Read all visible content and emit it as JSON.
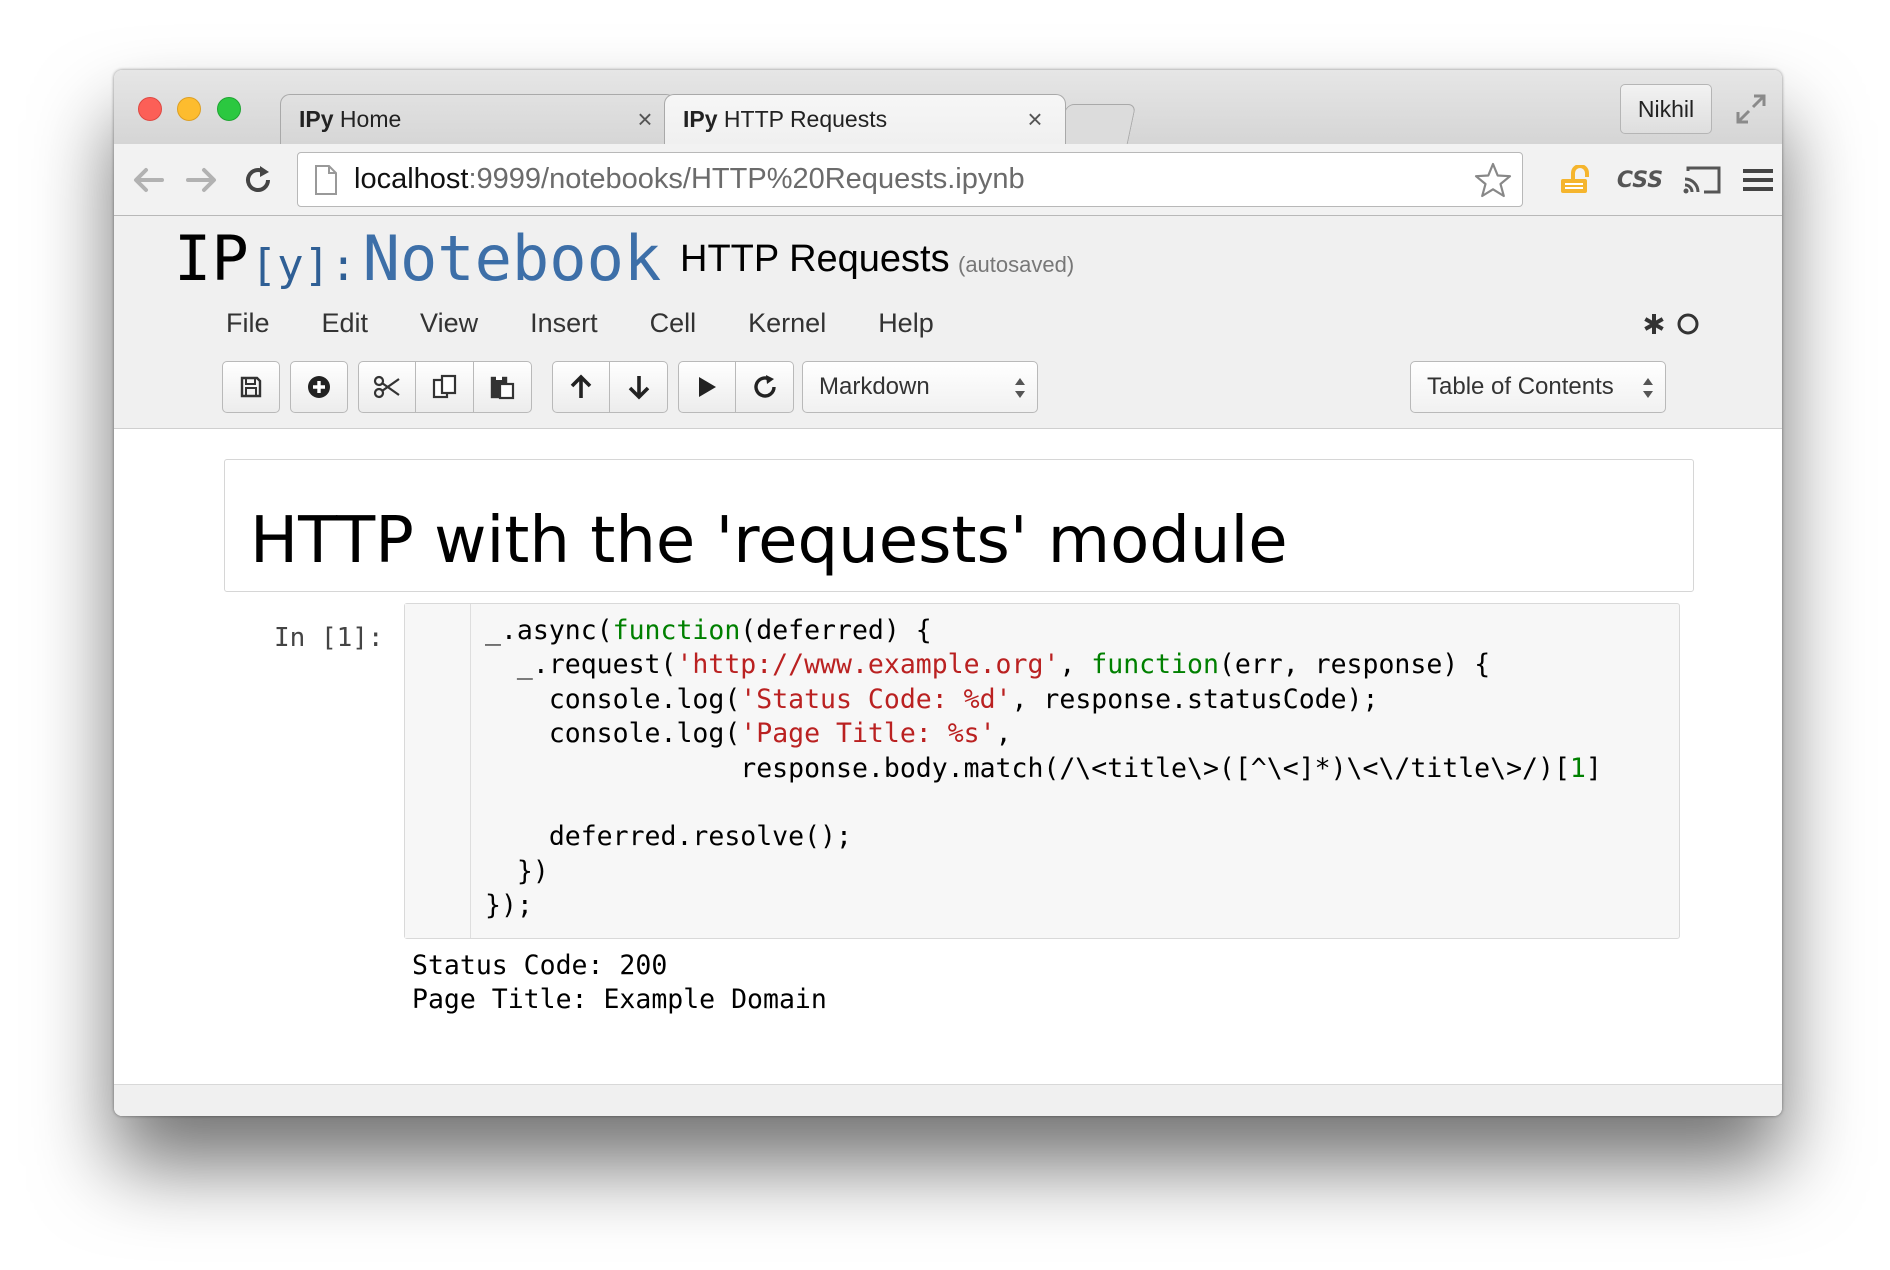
{
  "browser": {
    "tabs": [
      {
        "brand": "IPy",
        "label": "Home",
        "close": "×",
        "active": false
      },
      {
        "brand": "IPy",
        "label": "HTTP Requests",
        "close": "×",
        "active": true
      }
    ],
    "profile": "Nikhil",
    "url": {
      "host": "localhost",
      "rest": ":9999/notebooks/HTTP%20Requests.ipynb"
    },
    "extension_css": "CSS",
    "colors": {
      "red": "#fc5f57",
      "yellow": "#fdbc2e",
      "green": "#2bc840",
      "lock_gold": "#f5b52e"
    }
  },
  "notebook": {
    "logo": {
      "ip": "IP",
      "y": "[y]:",
      "name": "Notebook"
    },
    "title": "HTTP Requests",
    "save_status": "(autosaved)",
    "menu": [
      "File",
      "Edit",
      "View",
      "Insert",
      "Cell",
      "Kernel",
      "Help"
    ],
    "cell_type": "Markdown",
    "toc": "Table of Contents",
    "brand_blue": "#3d6fa8"
  },
  "cells": {
    "heading": "HTTP with the 'requests' module",
    "prompt": "In [1]:",
    "code_lines": [
      [
        {
          "t": "_.async("
        },
        {
          "t": "function",
          "c": "kw"
        },
        {
          "t": "(deferred) {"
        }
      ],
      [
        {
          "t": "  _.request("
        },
        {
          "t": "'http://www.example.org'",
          "c": "str"
        },
        {
          "t": ", "
        },
        {
          "t": "function",
          "c": "kw"
        },
        {
          "t": "(err, response) {"
        }
      ],
      [
        {
          "t": "    console.log("
        },
        {
          "t": "'Status Code: %d'",
          "c": "str"
        },
        {
          "t": ", response.statusCode);"
        }
      ],
      [
        {
          "t": "    console.log("
        },
        {
          "t": "'Page Title: %s'",
          "c": "str"
        },
        {
          "t": ","
        }
      ],
      [
        {
          "t": "                response.body.match(/\\<title\\>([^\\<]*)\\<\\/title\\>/)["
        },
        {
          "t": "1",
          "c": "num"
        },
        {
          "t": "]"
        }
      ],
      [
        {
          "t": ""
        }
      ],
      [
        {
          "t": "    deferred.resolve();"
        }
      ],
      [
        {
          "t": "  })"
        }
      ],
      [
        {
          "t": "});"
        }
      ]
    ],
    "output_lines": [
      "Status Code: 200",
      "Page Title: Example Domain"
    ]
  }
}
